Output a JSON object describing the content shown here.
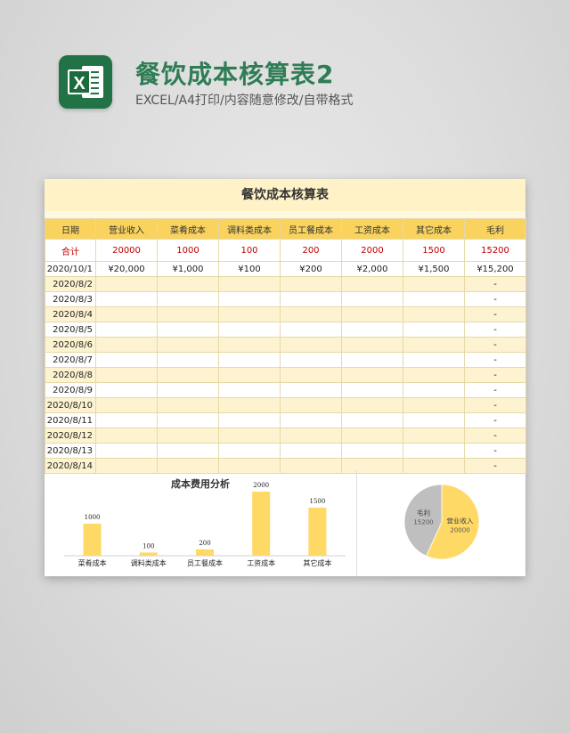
{
  "header": {
    "title": "餐饮成本核算表2",
    "subtitle": "EXCEL/A4打印/内容随意修改/自带格式"
  },
  "logo": {
    "letter": "X",
    "icon": "excel-icon",
    "color": "#217346"
  },
  "sheet": {
    "title": "餐饮成本核算表",
    "columns": [
      "日期",
      "营业收入",
      "菜肴成本",
      "调料类成本",
      "员工餐成本",
      "工资成本",
      "其它成本",
      "毛利"
    ],
    "total_row": [
      "合计",
      "20000",
      "1000",
      "100",
      "200",
      "2000",
      "1500",
      "15200"
    ],
    "rows": [
      [
        "2020/10/1",
        "¥20,000",
        "¥1,000",
        "¥100",
        "¥200",
        "¥2,000",
        "¥1,500",
        "¥15,200"
      ],
      [
        "2020/8/2",
        "",
        "",
        "",
        "",
        "",
        "",
        "-"
      ],
      [
        "2020/8/3",
        "",
        "",
        "",
        "",
        "",
        "",
        "-"
      ],
      [
        "2020/8/4",
        "",
        "",
        "",
        "",
        "",
        "",
        "-"
      ],
      [
        "2020/8/5",
        "",
        "",
        "",
        "",
        "",
        "",
        "-"
      ],
      [
        "2020/8/6",
        "",
        "",
        "",
        "",
        "",
        "",
        "-"
      ],
      [
        "2020/8/7",
        "",
        "",
        "",
        "",
        "",
        "",
        "-"
      ],
      [
        "2020/8/8",
        "",
        "",
        "",
        "",
        "",
        "",
        "-"
      ],
      [
        "2020/8/9",
        "",
        "",
        "",
        "",
        "",
        "",
        "-"
      ],
      [
        "2020/8/10",
        "",
        "",
        "",
        "",
        "",
        "",
        "-"
      ],
      [
        "2020/8/11",
        "",
        "",
        "",
        "",
        "",
        "",
        "-"
      ],
      [
        "2020/8/12",
        "",
        "",
        "",
        "",
        "",
        "",
        "-"
      ],
      [
        "2020/8/13",
        "",
        "",
        "",
        "",
        "",
        "",
        "-"
      ],
      [
        "2020/8/14",
        "",
        "",
        "",
        "",
        "",
        "",
        "-"
      ]
    ],
    "colors": {
      "header": "#f9d35e",
      "band": "#fdf3d1",
      "total_text": "#c00000"
    }
  },
  "chart_data": [
    {
      "type": "bar",
      "title": "成本费用分析",
      "categories": [
        "菜肴成本",
        "调料类成本",
        "员工餐成本",
        "工资成本",
        "其它成本"
      ],
      "values": [
        1000,
        100,
        200,
        2000,
        1500
      ],
      "ylim": [
        0,
        2000
      ],
      "color": "#ffd966",
      "grid": false
    },
    {
      "type": "pie",
      "slices": [
        {
          "label": "营业收入",
          "value": 20000,
          "color": "#ffd966"
        },
        {
          "label": "毛利",
          "value": 15200,
          "color": "#bfbfbf"
        }
      ]
    }
  ]
}
